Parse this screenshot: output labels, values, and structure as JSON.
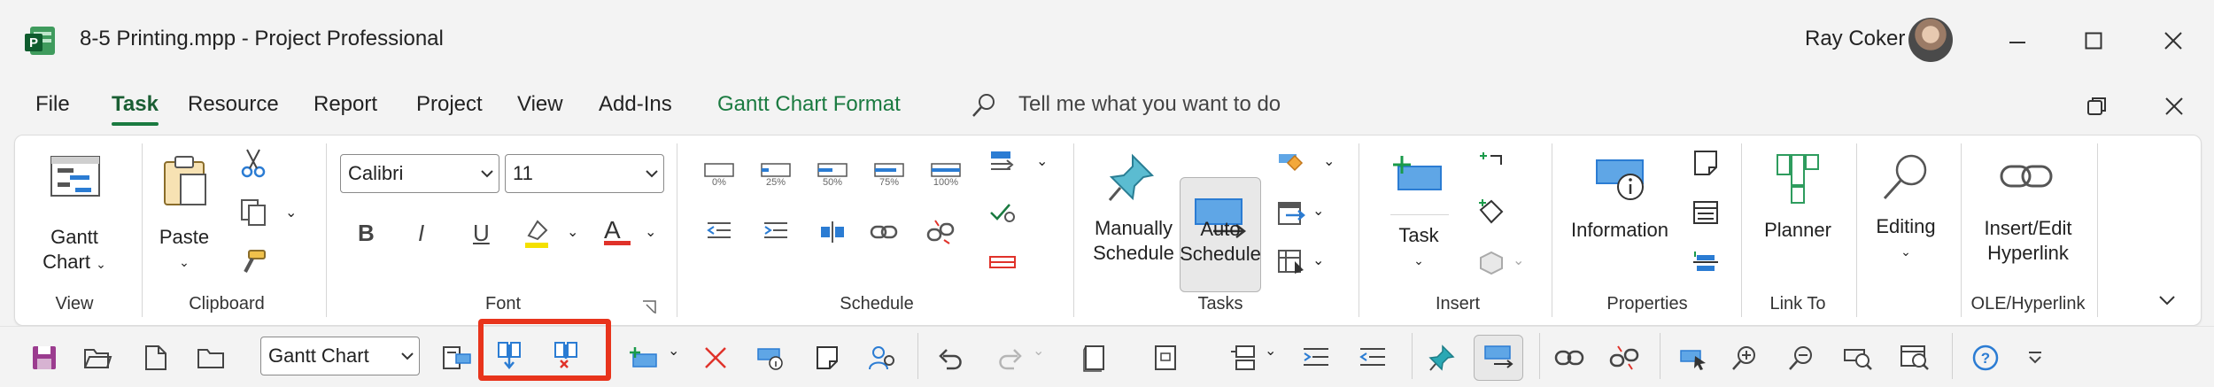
{
  "title_bar": {
    "document_title": "8-5 Printing.mpp  -  Project Professional",
    "user_name": "Ray Coker"
  },
  "menu": {
    "tabs": [
      "File",
      "Task",
      "Resource",
      "Report",
      "Project",
      "View",
      "Add-Ins",
      "Gantt Chart Format"
    ],
    "active_tab": "Task",
    "search_placeholder": "Tell me what you want to do"
  },
  "ribbon": {
    "view": {
      "gantt_line1": "Gantt",
      "gantt_line2": "Chart",
      "group": "View"
    },
    "clipboard": {
      "paste": "Paste",
      "group": "Clipboard"
    },
    "font": {
      "font_name": "Calibri",
      "font_size": "11",
      "bold": "B",
      "italic": "I",
      "underline": "U",
      "font_color": "A",
      "group": "Font"
    },
    "schedule": {
      "pct": [
        "0%",
        "25%",
        "50%",
        "75%",
        "100%"
      ],
      "group": "Schedule"
    },
    "tasks": {
      "manual_line1": "Manually",
      "manual_line2": "Schedule",
      "auto_line1": "Auto",
      "auto_line2": "Schedule",
      "group": "Tasks"
    },
    "insert": {
      "task": "Task",
      "group": "Insert"
    },
    "properties": {
      "information": "Information",
      "group": "Properties"
    },
    "linkto": {
      "planner": "Planner",
      "group": "Link To"
    },
    "editing": {
      "label": "Editing"
    },
    "ole": {
      "line1": "Insert/Edit",
      "line2": "Hyperlink",
      "group": "OLE/Hyperlink"
    }
  },
  "quick_access": {
    "view_select": "Gantt Chart"
  },
  "colors": {
    "accent": "#1a7a40",
    "highlight": "#e8341c",
    "blue": "#2b7cd3",
    "red": "#e0322a"
  }
}
